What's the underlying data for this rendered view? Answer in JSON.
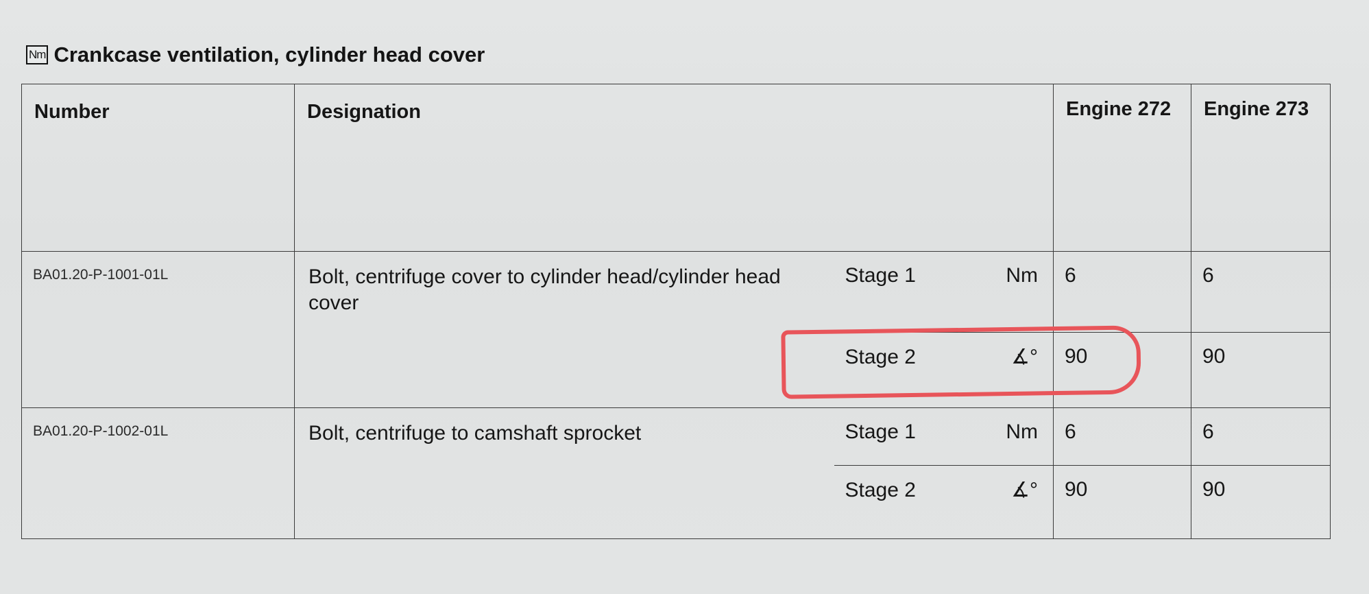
{
  "header": {
    "icon_label": "Nm",
    "title": "Crankcase ventilation, cylinder head cover"
  },
  "table": {
    "headers": {
      "number": "Number",
      "designation": "Designation",
      "engine_272": "Engine 272",
      "engine_273": "Engine 273"
    },
    "rows": [
      {
        "number": "BA01.20-P-1001-01L",
        "designation": "Bolt, centrifuge cover to cylinder head/cylinder head cover",
        "stage1": {
          "label": "Stage 1",
          "unit": "Nm",
          "e272": "6",
          "e273": "6"
        },
        "stage2": {
          "label": "Stage 2",
          "unit": "∡°",
          "e272": "90",
          "e273": "90"
        }
      },
      {
        "number": "BA01.20-P-1002-01L",
        "designation": "Bolt, centrifuge to camshaft sprocket",
        "stage1": {
          "label": "Stage 1",
          "unit": "Nm",
          "e272": "6",
          "e273": "6"
        },
        "stage2": {
          "label": "Stage 2",
          "unit": "∡°",
          "e272": "90",
          "e273": "90"
        }
      }
    ]
  },
  "annotation": {
    "color": "#e8555a"
  }
}
